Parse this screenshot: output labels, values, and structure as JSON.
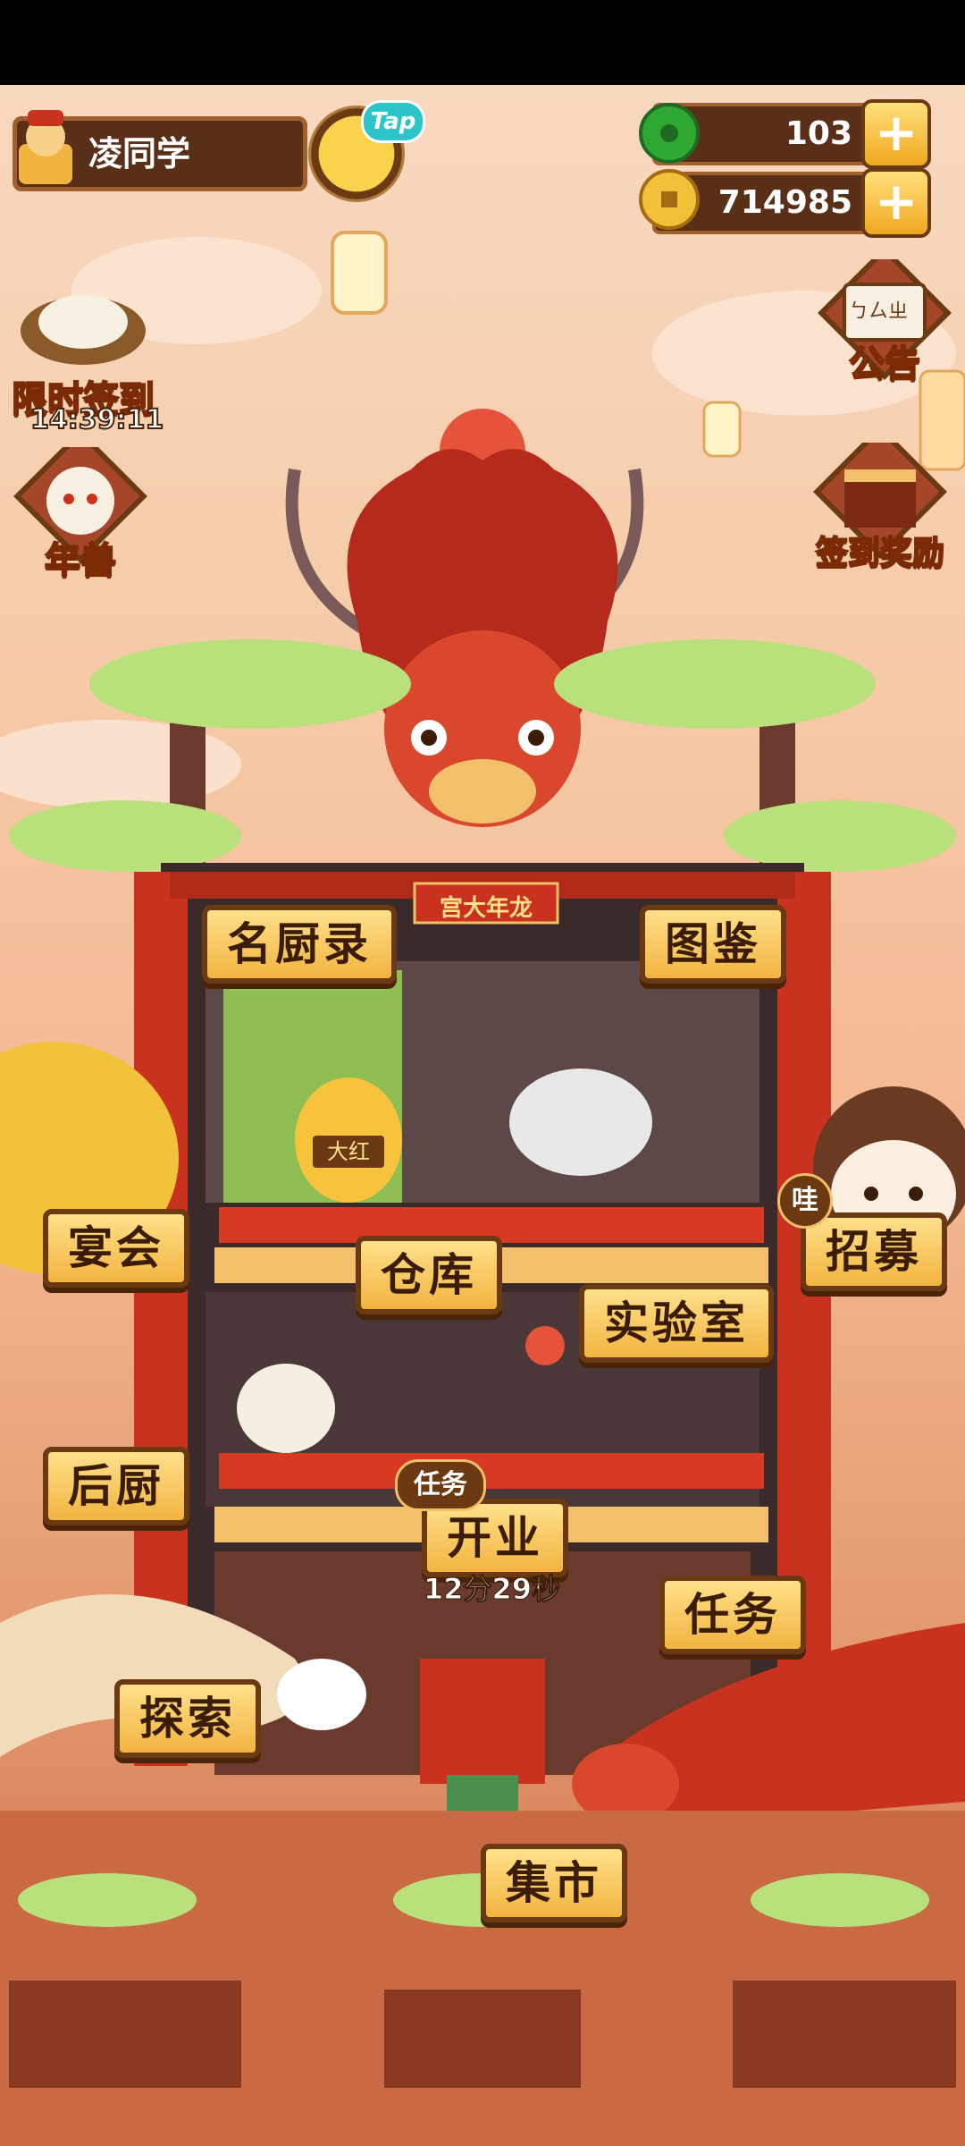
{
  "hud": {
    "player_name": "凌同学",
    "tap_badge": "Tap",
    "jade_count": "103",
    "coin_count": "714985",
    "plus": "+"
  },
  "left_panel": {
    "signin_label": "限时签到",
    "signin_timer": "14:39:11",
    "nian_label": "年兽"
  },
  "right_panel": {
    "notice_icon_text": "ㄅㄙㄓ",
    "notice_label": "公告",
    "reward_label": "签到奖励"
  },
  "building": {
    "sign": "宫大年龙",
    "shop_sign": "大红"
  },
  "buttons": {
    "chefs": "名厨录",
    "atlas": "图鉴",
    "banquet": "宴会",
    "warehouse": "仓库",
    "lab": "实验室",
    "recruit": "招募",
    "recruit_badge": "哇",
    "kitchen": "后厨",
    "task_badge": "任务",
    "open": "开业",
    "open_timer": "12分29秒",
    "task": "任务",
    "explore": "探索",
    "market": "集市"
  },
  "colors": {
    "label_fill": "#f2b440",
    "label_border": "#6b3a12",
    "accent_red": "#c8321e",
    "jade": "#2fa832",
    "coin": "#f2c13a"
  }
}
